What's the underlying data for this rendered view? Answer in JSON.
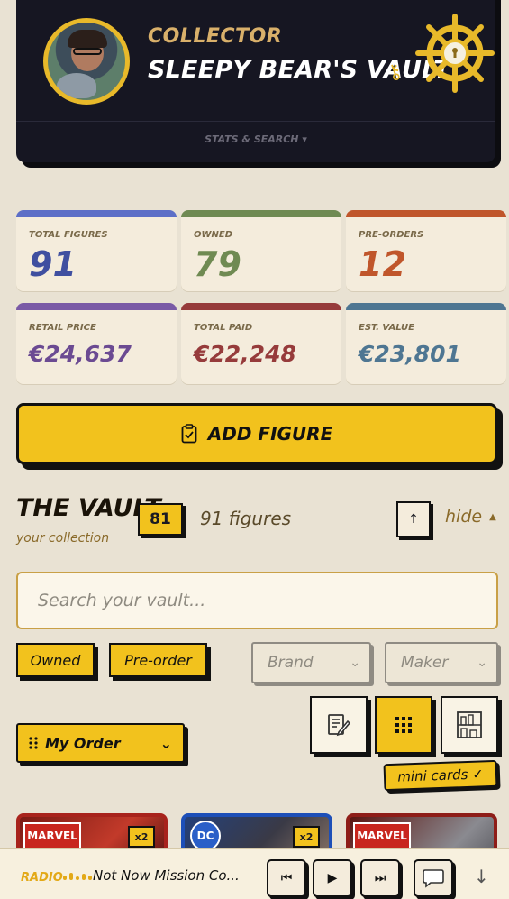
{
  "header": {
    "collector_label": "COLLECTOR",
    "vault_title": "SLEEPY BEAR'S VAULT",
    "stats_toggle": "STATS & SEARCH ▾",
    "icons": [
      "avatar",
      "key-icon",
      "ship-wheel-icon"
    ]
  },
  "stats": [
    {
      "label": "TOTAL FIGURES",
      "value": "91",
      "color": "#3f4fa0",
      "accent": "#5d6fc7"
    },
    {
      "label": "OWNED",
      "value": "79",
      "color": "#6f8a52",
      "accent": "#6f8a52"
    },
    {
      "label": "PRE-ORDERS",
      "value": "12",
      "color": "#c0562b",
      "accent": "#c0562b"
    },
    {
      "label": "RETAIL PRICE",
      "value": "€24,637",
      "color": "#6b4a92",
      "accent": "#7a5aa6"
    },
    {
      "label": "TOTAL PAID",
      "value": "€22,248",
      "color": "#963b3b",
      "accent": "#963b3b"
    },
    {
      "label": "EST. VALUE",
      "value": "€23,801",
      "color": "#4e7692",
      "accent": "#4e7692"
    }
  ],
  "add_button": {
    "label": "ADD FIGURE",
    "icon": "clipboard-icon"
  },
  "vault": {
    "title": "THE VAULT",
    "subtitle": "your collection",
    "count": "81",
    "figures_text": "91 figures",
    "scroll_up": "↑",
    "hide_label": "hide",
    "hide_caret": "▲"
  },
  "search": {
    "placeholder": "Search your vault..."
  },
  "filters": {
    "owned": "Owned",
    "preorder": "Pre-order",
    "brand": "Brand",
    "maker": "Maker",
    "order": "My Order",
    "order_chevron": "⌄"
  },
  "view": {
    "mini_cards_label": "mini cards ✓",
    "buttons": [
      "edit-list-icon",
      "grid-icon",
      "shelf-icon"
    ]
  },
  "cards": [
    {
      "brand": "MARVEL",
      "qty": "x2",
      "border": "#a8231c",
      "bg": "#b5281e"
    },
    {
      "brand": "DC",
      "qty": "x2",
      "border": "#1d4fb8",
      "bg": "#2a5fc8"
    },
    {
      "brand": "MARVEL",
      "qty": "",
      "border": "#8e1d18",
      "bg": "#a0231c"
    }
  ],
  "radio": {
    "label": "RADIO",
    "track": "Not Now Mission Co...",
    "prev": "⏮",
    "play": "▶",
    "next": "⏭",
    "down": "↓"
  }
}
